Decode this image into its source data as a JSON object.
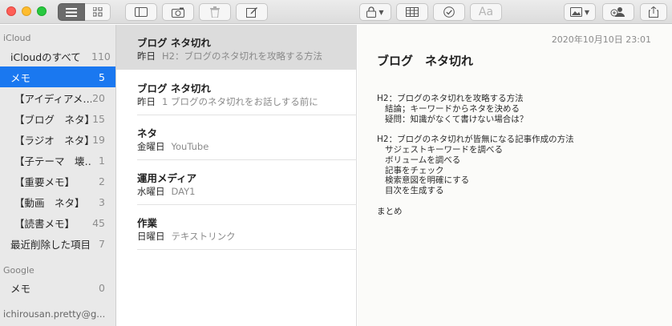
{
  "toolbar": {
    "buttons": [
      "list-view",
      "gallery-view",
      "toggle-sidebar",
      "attachments",
      "delete",
      "compose",
      "lock",
      "table",
      "checklist",
      "format",
      "media",
      "add-people",
      "share"
    ],
    "format_label": "Aa"
  },
  "sidebar": {
    "icloud_heading": "iCloud",
    "items": [
      {
        "label": "iCloudのすべて",
        "count": "110"
      },
      {
        "label": "メモ",
        "count": "5"
      },
      {
        "label": "【アイディアメ…",
        "count": "20"
      },
      {
        "label": "【ブログ　ネタ】",
        "count": "15"
      },
      {
        "label": "【ラジオ　ネタ】",
        "count": "19"
      },
      {
        "label": "【子テーマ　壊…",
        "count": "1"
      },
      {
        "label": "【重要メモ】",
        "count": "2"
      },
      {
        "label": "【動画　ネタ】",
        "count": "3"
      },
      {
        "label": "【読書メモ】",
        "count": "45"
      },
      {
        "label": "最近削除した項目",
        "count": "7"
      }
    ],
    "google_heading": "Google",
    "google_items": [
      {
        "label": "メモ",
        "count": "0"
      }
    ],
    "account": "ichirousan.pretty@g..."
  },
  "notes": [
    {
      "title": "ブログ ネタ切れ",
      "date": "昨日",
      "preview": "H2：ブログのネタ切れを攻略する方法"
    },
    {
      "title": "ブログ ネタ切れ",
      "date": "昨日",
      "preview": "1 ブログのネタ切れをお話しする前に"
    },
    {
      "title": "ネタ",
      "date": "金曜日",
      "preview": "YouTube"
    },
    {
      "title": "運用メディア",
      "date": "水曜日",
      "preview": "DAY1"
    },
    {
      "title": "作業",
      "date": "日曜日",
      "preview": "テキストリンク"
    }
  ],
  "editor": {
    "date": "2020年10月10日 23:01",
    "title": "ブログ　ネタ切れ",
    "body": "H2：ブログのネタ切れを攻略する方法\n   結論；キーワードからネタを決める\n   疑問：知識がなくて書けない場合は？\n\nH2：ブログのネタ切れが皆無になる記事作成の方法\n   サジェストキーワードを調べる\n   ボリュームを調べる\n   記事をチェック\n   検索意図を明確にする\n   目次を生成する\n\nまとめ"
  },
  "colors": {
    "accent": "#1a78f0",
    "close": "#fe5f57",
    "minimize": "#febc2e",
    "maximize": "#28c840"
  }
}
